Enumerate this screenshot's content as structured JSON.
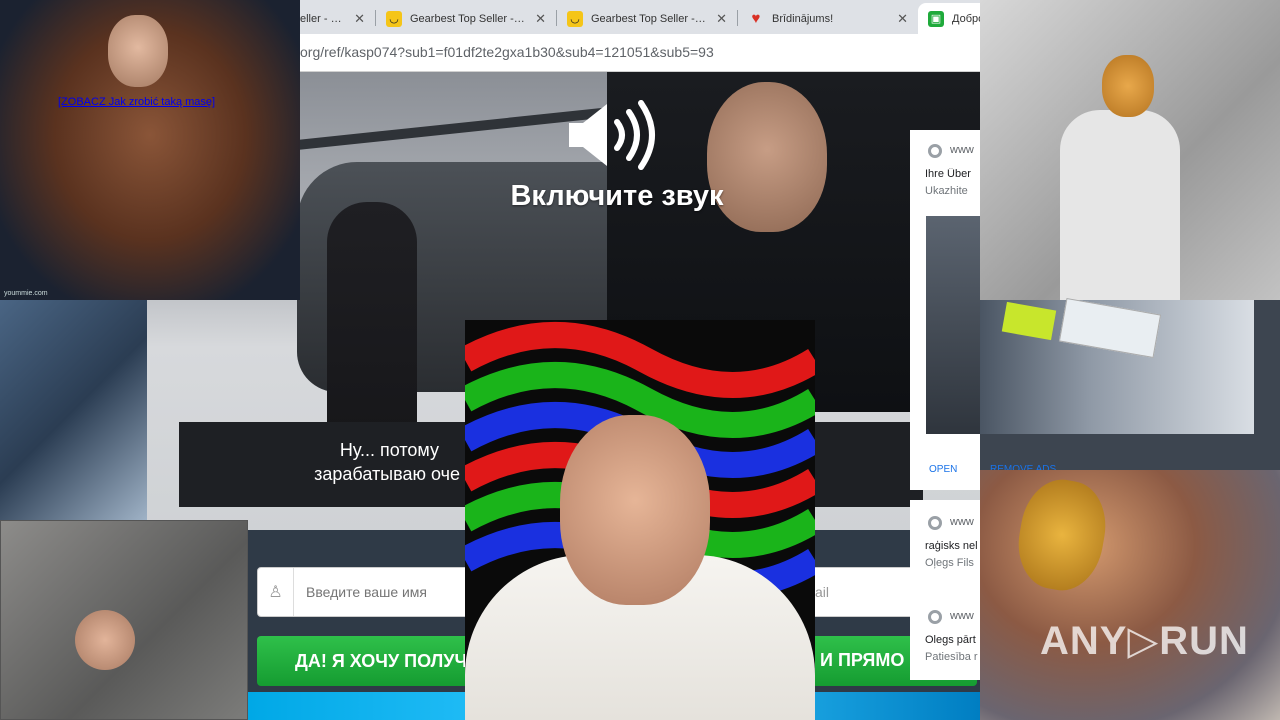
{
  "browser": {
    "tabs": [
      {
        "label": "eller - Div",
        "icon": "green-tab-icon",
        "active": false
      },
      {
        "label": "Gearbest Top Seller - Div",
        "icon": "gearbest-icon",
        "active": false
      },
      {
        "label": "Gearbest Top Seller - Div",
        "icon": "gearbest-icon",
        "active": false
      },
      {
        "label": "Brīdinājums!",
        "icon": "heart-icon",
        "active": false
      },
      {
        "label": "Добро",
        "icon": "green-square-icon",
        "active": true
      }
    ],
    "url": "org/ref/kasp074?sub1=f01df2te2gxa1b30&sub4=121051&sub5=93"
  },
  "video": {
    "sound_prompt": "Включите звук",
    "subtitle_line1": "Ну... потому                                                          ите,",
    "subtitle_line2": "зарабатываю оче                                                  вертолет."
  },
  "form": {
    "name_placeholder": "Введите ваше имя",
    "email_placeholder": "ail",
    "cta_left": "ДА! Я ХОЧУ ПОЛУЧ",
    "cta_right": "И ПРЯМО СЕ"
  },
  "ad": {
    "block1_www": "www",
    "block1_title": "Ihre Über",
    "block1_sub": "Ukazhite",
    "open_label": "OPEN",
    "remove_label": "REMOVE ADS",
    "block2_www": "www",
    "block2_title": "raģisks nel",
    "block2_sub": "Oļegs Fils",
    "block3_www": "www",
    "block3_title": "Olegs pārt",
    "block3_sub": "Patiesība r"
  },
  "overlays": {
    "bodybuilder_link": "[ZOBACZ Jak zrobić taką masę]",
    "bodybuilder_footer": "yoummie.com",
    "watermark": "ANY▷RUN"
  },
  "colors": {
    "cta_green": "#1fae3b",
    "link_blue": "#1a73e8"
  }
}
